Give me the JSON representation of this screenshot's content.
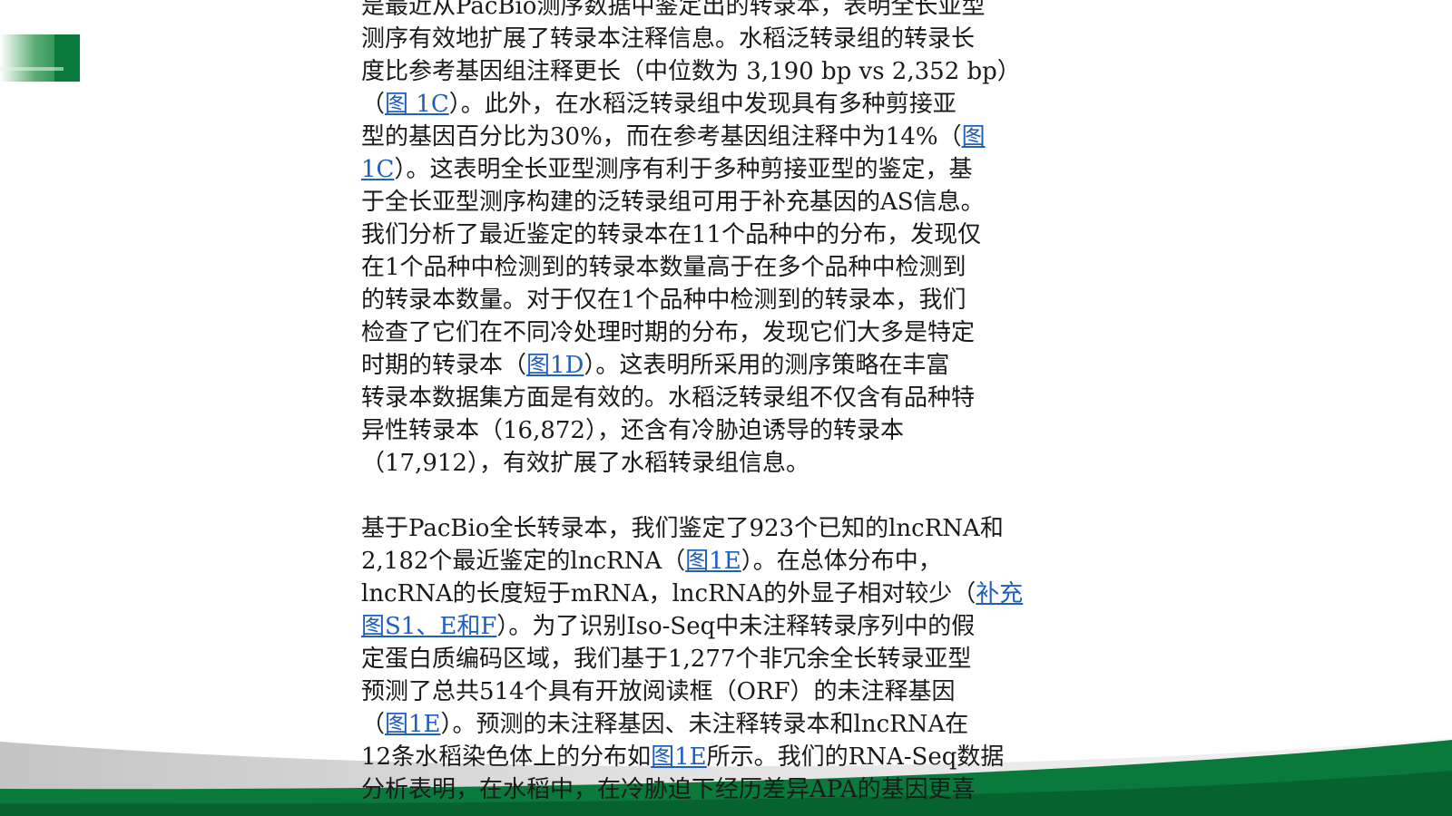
{
  "colors": {
    "brand_green": "#0a7a3c",
    "dark_green": "#06632f",
    "light_green": "#58ad72",
    "silver": "#c9c9c9",
    "link": "#1f5fbf"
  },
  "paragraph1": [
    [
      {
        "t": "是最近从PacBio测序数据中鉴定出的转录本，表明全长亚型"
      }
    ],
    [
      {
        "t": "测序有效地扩展了转录本注释信息。水稻泛转录组的转录长"
      }
    ],
    [
      {
        "t": "度比参考基因组注释更长（中位数为 3,190 bp vs 2,352 bp）"
      }
    ],
    [
      {
        "t": "（"
      },
      {
        "t": "图 1C",
        "link": true
      },
      {
        "t": "）。此外，在水稻泛转录组中发现具有多种剪接亚"
      }
    ],
    [
      {
        "t": "型的基因百分比为30%，而在参考基因组注释中为14%（"
      },
      {
        "t": "图",
        "link": true
      }
    ],
    [
      {
        "t": "1C",
        "link": true
      },
      {
        "t": "）。这表明全长亚型测序有利于多种剪接亚型的鉴定，基"
      }
    ],
    [
      {
        "t": "于全长亚型测序构建的泛转录组可用于补充基因的AS信息。"
      }
    ],
    [
      {
        "t": "我们分析了最近鉴定的转录本在11个品种中的分布，发现仅"
      }
    ],
    [
      {
        "t": "在1个品种中检测到的转录本数量高于在多个品种中检测到"
      }
    ],
    [
      {
        "t": "的转录本数量。对于仅在1个品种中检测到的转录本，我们"
      }
    ],
    [
      {
        "t": "检查了它们在不同冷处理时期的分布，发现它们大多是特定"
      }
    ],
    [
      {
        "t": "时期的转录本（"
      },
      {
        "t": "图1D",
        "link": true
      },
      {
        "t": "）。这表明所采用的测序策略在丰富"
      }
    ],
    [
      {
        "t": "转录本数据集方面是有效的。水稻泛转录组不仅含有品种特"
      }
    ],
    [
      {
        "t": "异性转录本（16,872），还含有冷胁迫诱导的转录本"
      }
    ],
    [
      {
        "t": "（17,912），有效扩展了水稻转录组信息。"
      }
    ]
  ],
  "paragraph2": [
    [
      {
        "t": "基于PacBio全长转录本，我们鉴定了923个已知的lncRNA和"
      }
    ],
    [
      {
        "t": "2,182个最近鉴定的lncRNA（"
      },
      {
        "t": "图1E",
        "link": true
      },
      {
        "t": "）。在总体分布中，"
      }
    ],
    [
      {
        "t": "lncRNA的长度短于mRNA，lncRNA的外显子相对较少（"
      },
      {
        "t": "补充",
        "link": true
      }
    ],
    [
      {
        "t": "图S1、E和F",
        "link": true
      },
      {
        "t": "）。为了识别Iso-Seq中未注释转录序列中的假"
      }
    ],
    [
      {
        "t": "定蛋白质编码区域，我们基于1,277个非冗余全长转录亚型"
      }
    ],
    [
      {
        "t": "预测了总共514个具有开放阅读框（ORF）的未注释基因"
      }
    ],
    [
      {
        "t": "（"
      },
      {
        "t": "图1E",
        "link": true
      },
      {
        "t": "）。预测的未注释基因、未注释转录本和lncRNA在"
      }
    ],
    [
      {
        "t": "12条水稻染色体上的分布如"
      },
      {
        "t": "图1E",
        "link": true
      },
      {
        "t": "所示。我们的RNA-Seq数据"
      }
    ],
    [
      {
        "t": "分析表明，在水稻中，在冷胁迫下经历差异APA的基因更喜"
      }
    ]
  ]
}
